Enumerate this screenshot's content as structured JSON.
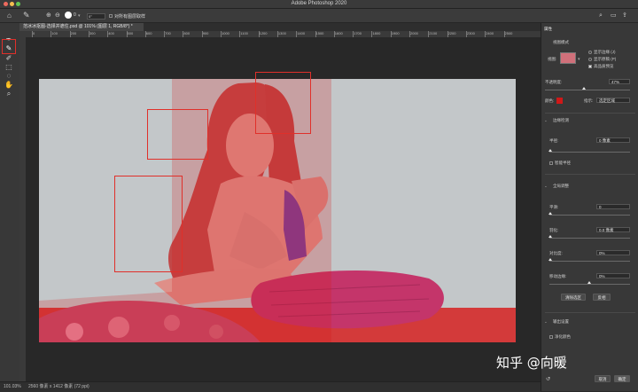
{
  "app": {
    "title": "Adobe Photoshop 2020"
  },
  "options_bar": {
    "brush_size": "0",
    "sample_all_layers": "对所有图层取样",
    "angle": "0°"
  },
  "tab": {
    "label": "范冰冰抠图-选择并遮住.psd @ 101% (图层 1, RGB/8*) *"
  },
  "ruler": {
    "ticks": [
      "0",
      "100",
      "200",
      "300",
      "400",
      "500",
      "600",
      "700",
      "800",
      "900",
      "1000",
      "1100",
      "1200",
      "1300",
      "1400",
      "1500",
      "1600",
      "1700",
      "1800",
      "1900",
      "2000",
      "2100",
      "2200",
      "2300",
      "2400",
      "2500"
    ]
  },
  "status": {
    "zoom": "101.03%",
    "doc_info": "2560 像素 x 1412 像素 (72 ppi)"
  },
  "panel": {
    "header": "属性",
    "view_mode": {
      "label": "视图模式",
      "view_label": "视图:",
      "show_edges": "显示边缘 (J)",
      "show_original": "显示原稿 (P)",
      "high_quality": "高品质预览"
    },
    "opacity": {
      "label": "不透明度:",
      "value": "47%"
    },
    "color": {
      "label": "颜色:",
      "swatch": "#d01818",
      "indicates_label": "指示:",
      "indicates_value": "选定区域"
    },
    "edge_detection": {
      "header": "边缘检测",
      "radius_label": "半径:",
      "radius_value": "0 像素",
      "smart_radius": "智能半径"
    },
    "global": {
      "header": "全局调整",
      "smooth_label": "平滑:",
      "smooth_value": "0",
      "feather_label": "羽化:",
      "feather_value": "0.0 像素",
      "contrast_label": "对比度:",
      "contrast_value": "0%",
      "shift_label": "移动边缘:",
      "shift_value": "0%",
      "clear_button": "清除选区",
      "invert_button": "反相"
    },
    "output": {
      "header": "输出设置",
      "decontaminate": "净化颜色"
    },
    "cancel_button": "取消",
    "ok_button": "确定"
  },
  "watermark": "知乎 @向暖"
}
